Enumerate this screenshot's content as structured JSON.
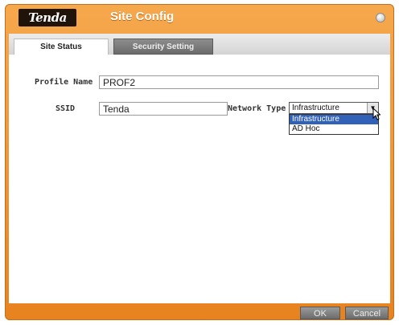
{
  "window": {
    "logo": "Tenda",
    "title": "Site Config"
  },
  "tabs": [
    {
      "label": "Site Status",
      "active": true
    },
    {
      "label": "Security Setting",
      "active": false
    }
  ],
  "form": {
    "profile_name_label": "Profile Name",
    "profile_name_value": "PROF2",
    "ssid_label": "SSID",
    "ssid_value": "Tenda",
    "network_type_label": "Network Type",
    "network_type_value": "Infrastructure",
    "network_type_options": [
      "Infrastructure",
      "AD Hoc"
    ]
  },
  "buttons": {
    "ok": "OK",
    "cancel": "Cancel"
  },
  "colors": {
    "frame_orange": "#e7831f",
    "selection_blue": "#3262b8",
    "logo_bg": "#1f130a"
  }
}
